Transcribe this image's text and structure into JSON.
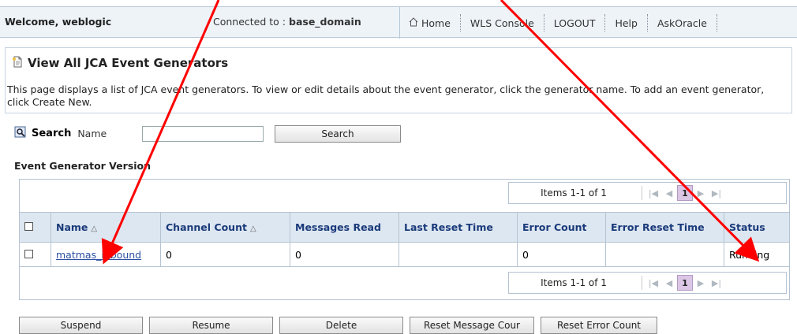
{
  "header": {
    "welcome": "Welcome, weblogic",
    "connected_prefix": "Connected to : ",
    "domain": "base_domain",
    "nav": [
      {
        "label": "Home",
        "icon": "home-icon"
      },
      {
        "label": "WLS Console"
      },
      {
        "label": "LOGOUT"
      },
      {
        "label": "Help"
      },
      {
        "label": "AskOracle"
      }
    ]
  },
  "page": {
    "title": "View All JCA Event Generators",
    "description": "This page displays a list of JCA event generators. To view or edit details about the event generator, click the generator name. To add an event generator, click Create New."
  },
  "search": {
    "label": "Search",
    "field_label": "Name",
    "value": "",
    "button": "Search"
  },
  "section_title": "Event Generator Version",
  "pager": {
    "items_text": "Items 1-1 of 1",
    "current_page": "1"
  },
  "table": {
    "columns": [
      "Name",
      "Channel Count",
      "Messages Read",
      "Last Reset Time",
      "Error Count",
      "Error Reset Time",
      "Status"
    ],
    "rows": [
      {
        "name": "matmas_inbound",
        "channel_count": "0",
        "messages_read": "0",
        "last_reset_time": "",
        "error_count": "0",
        "error_reset_time": "",
        "status": "Running"
      }
    ]
  },
  "actions": [
    "Suspend",
    "Resume",
    "Delete",
    "Reset Message Cour",
    "Reset Error Count"
  ],
  "colors": {
    "annotation_arrow": "#ff0000",
    "link": "#2a4ea0",
    "header_bg": "#dde7f1"
  }
}
